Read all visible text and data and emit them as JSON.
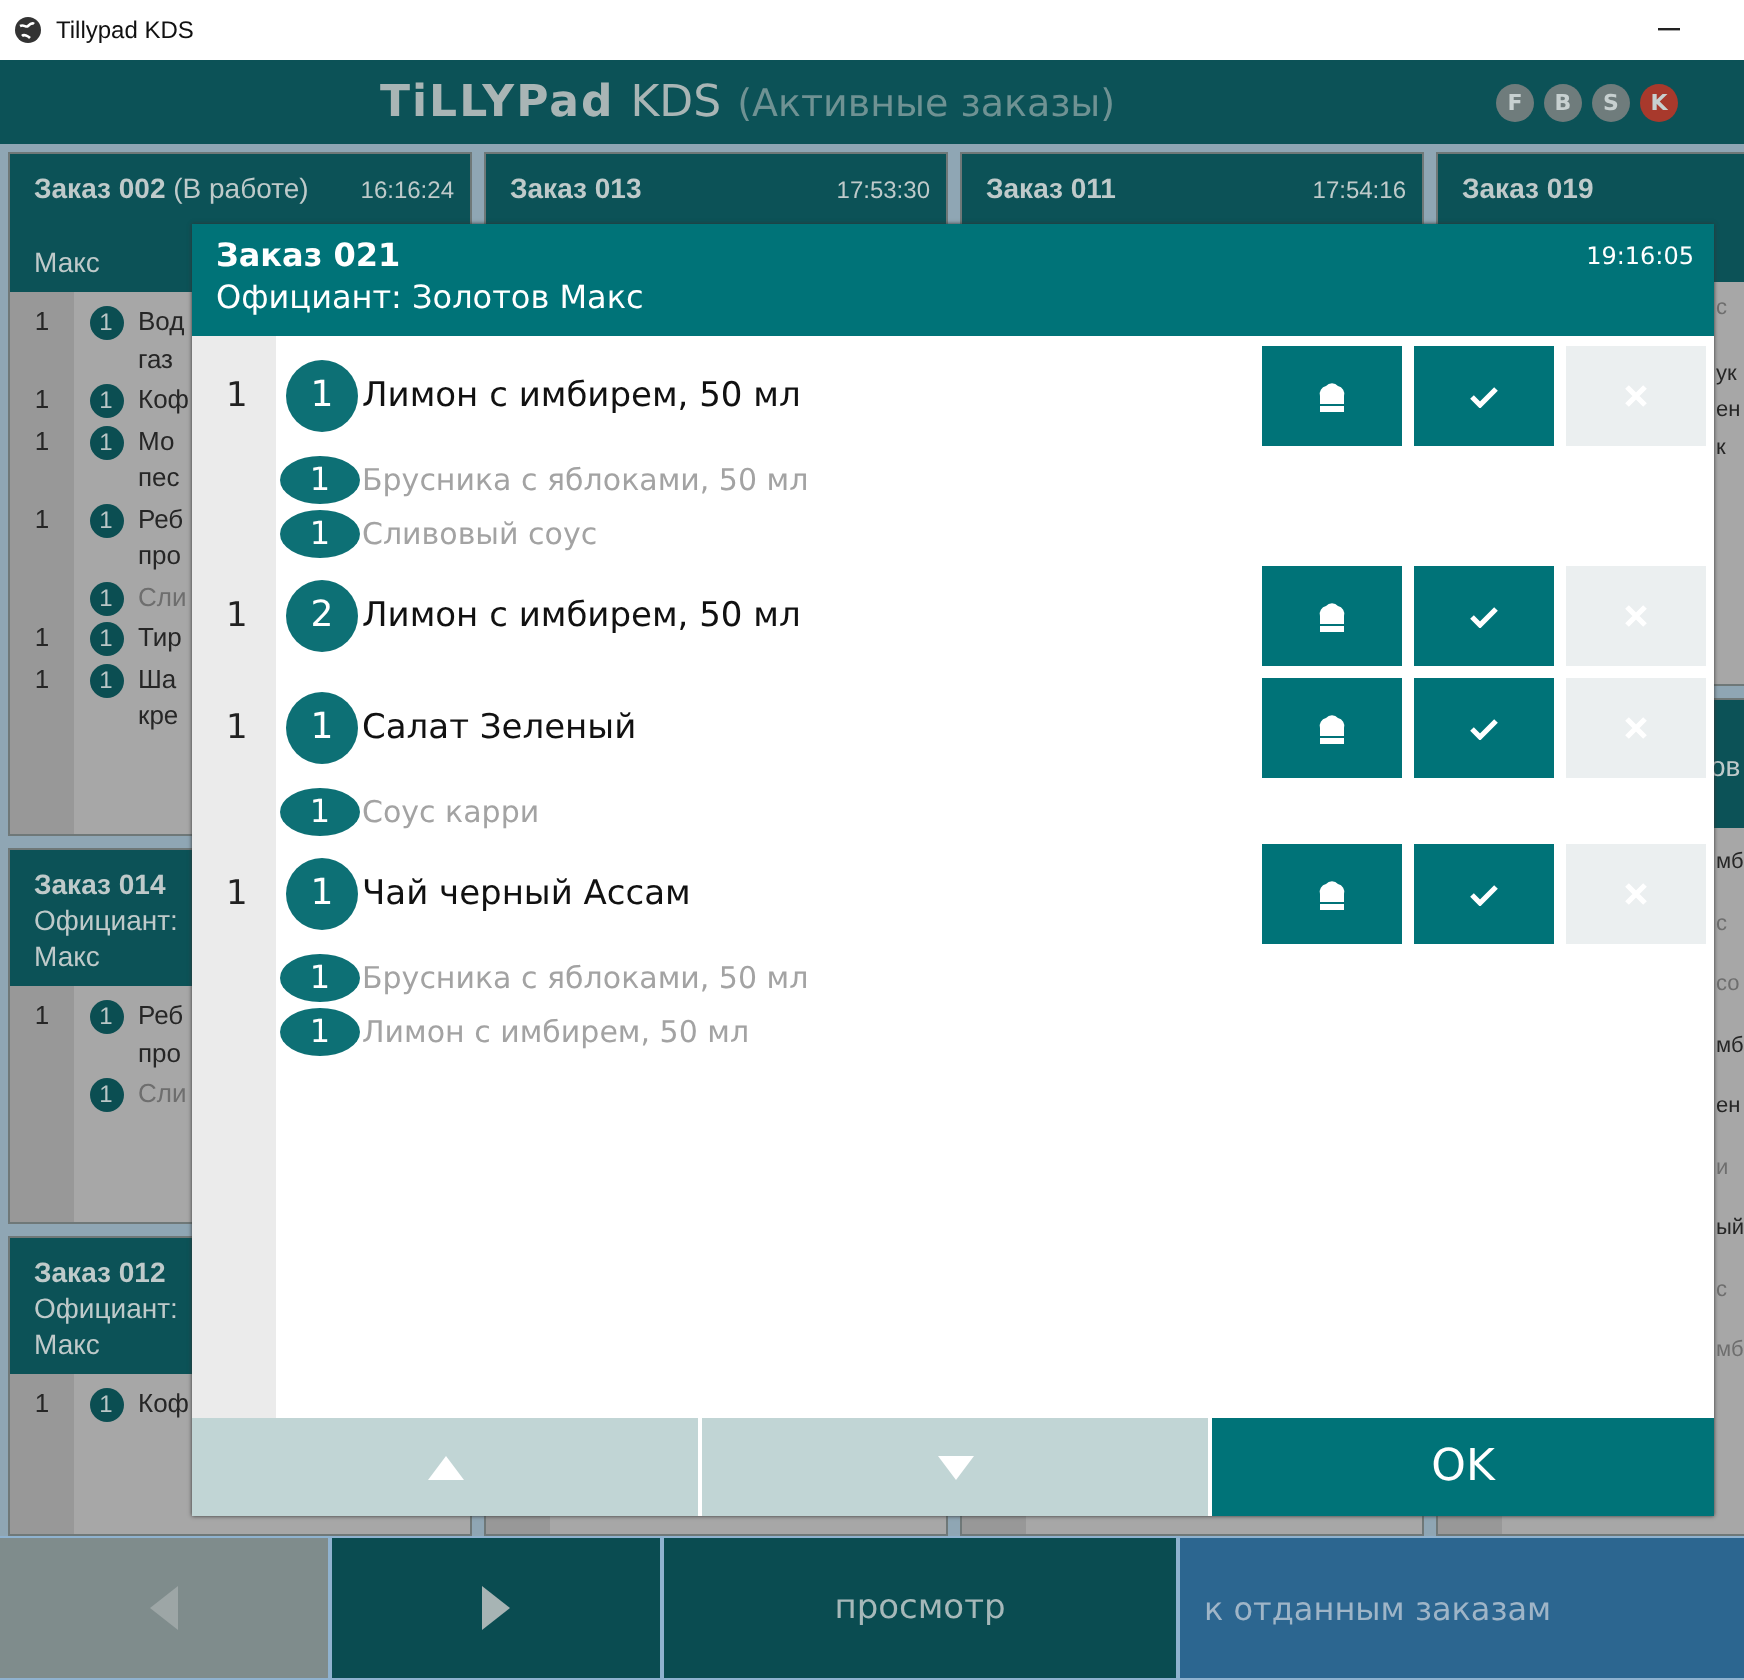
{
  "window": {
    "title": "Tillypad KDS"
  },
  "header": {
    "logo": "TiLLYPad",
    "product": "KDS",
    "view": "(Активные заказы)",
    "stations": [
      {
        "label": "F",
        "color": "#6f7c7c"
      },
      {
        "label": "B",
        "color": "#6f7c7c"
      },
      {
        "label": "S",
        "color": "#6f7c7c"
      },
      {
        "label": "K",
        "color": "#a8392c"
      }
    ]
  },
  "columns": [
    {
      "cards": [
        {
          "title": "**Заказ 002** (В работе)",
          "time": "16:16:24",
          "waiter": [
            "Макс"
          ],
          "items": [
            {
              "kind": "dish",
              "qty": "1",
              "count": "1",
              "lines": [
                "Вод",
                "газ"
              ]
            },
            {
              "kind": "dish",
              "qty": "1",
              "count": "1",
              "lines": [
                "Коф"
              ]
            },
            {
              "kind": "dish",
              "qty": "1",
              "count": "1",
              "lines": [
                "Мо",
                "пес"
              ]
            },
            {
              "kind": "dish",
              "qty": "1",
              "count": "1",
              "lines": [
                "Реб",
                "про"
              ]
            },
            {
              "kind": "modifier",
              "count": "1",
              "lines": [
                "Сли"
              ]
            },
            {
              "kind": "dish",
              "qty": "1",
              "count": "1",
              "lines": [
                "Тир"
              ]
            },
            {
              "kind": "dish",
              "qty": "1",
              "count": "1",
              "lines": [
                "Ша",
                "кре"
              ]
            }
          ]
        },
        {
          "title": "**Заказ 014**",
          "waiter": [
            "Официант:",
            "Макс"
          ],
          "items": [
            {
              "kind": "dish",
              "qty": "1",
              "count": "1",
              "lines": [
                "Реб",
                "про"
              ]
            },
            {
              "kind": "modifier",
              "count": "1",
              "lines": [
                "Сли"
              ]
            }
          ]
        },
        {
          "title": "**Заказ 012**",
          "waiter": [
            "Официант:",
            "Макс"
          ],
          "items": [
            {
              "kind": "dish",
              "qty": "1",
              "count": "1",
              "lines": [
                "Коф"
              ]
            }
          ]
        }
      ]
    },
    {
      "cards": [
        {
          "title": "**Заказ 013**",
          "time": "17:53:30"
        }
      ]
    },
    {
      "cards": [
        {
          "title": "**Заказ 011**",
          "time": "17:54:16"
        }
      ]
    },
    {
      "cards": [
        {
          "title": "**Заказ 019**",
          "items": [
            {
              "kind": "modifier",
              "lines": [
                "с"
              ]
            },
            {
              "kind": "dish",
              "lines": [
                "ук",
                "ен",
                "к"
              ]
            }
          ]
        },
        {
          "waiter": [
            "ов"
          ],
          "items": [
            {
              "kind": "dish",
              "lines": [
                "мб"
              ]
            },
            {
              "kind": "modifier",
              "lines": [
                "с"
              ]
            },
            {
              "kind": "modifier",
              "lines": [
                "со"
              ]
            },
            {
              "kind": "dish",
              "lines": [
                "мб"
              ]
            },
            {
              "kind": "dish",
              "lines": [
                "ен"
              ]
            },
            {
              "kind": "modifier",
              "lines": [
                "и"
              ]
            },
            {
              "kind": "dish",
              "lines": [
                "ый"
              ]
            },
            {
              "kind": "modifier",
              "lines": [
                "с"
              ]
            },
            {
              "kind": "modifier",
              "lines": [
                "мб"
              ]
            }
          ]
        }
      ]
    }
  ],
  "dialog": {
    "title": "Заказ 021",
    "waiter": "Официант: Золотов Макс",
    "time": "19:16:05",
    "items": [
      {
        "kind": "dish",
        "qty": "1",
        "count": "1",
        "name": "Лимон с имбирем, 50 мл",
        "cancel_disabled": true
      },
      {
        "kind": "modifier",
        "count": "1",
        "name": "Брусника с яблоками, 50 мл"
      },
      {
        "kind": "modifier",
        "count": "1",
        "name": "Сливовый соус"
      },
      {
        "kind": "dish",
        "qty": "1",
        "count": "2",
        "name": "Лимон с имбирем, 50 мл",
        "cancel_disabled": true
      },
      {
        "kind": "dish",
        "qty": "1",
        "count": "1",
        "name": "Салат Зеленый",
        "cancel_disabled": true
      },
      {
        "kind": "modifier",
        "count": "1",
        "name": "Соус карри"
      },
      {
        "kind": "dish",
        "qty": "1",
        "count": "1",
        "name": "Чай черный Ассам",
        "cancel_disabled": true
      },
      {
        "kind": "modifier",
        "count": "1",
        "name": "Брусника с яблоками, 50 мл"
      },
      {
        "kind": "modifier",
        "count": "1",
        "name": "Лимон с имбирем, 50 мл"
      }
    ],
    "ok": "OK"
  },
  "bottom_bar": [
    {
      "kind": "prev",
      "disabled": true
    },
    {
      "kind": "next",
      "disabled": false
    },
    {
      "kind": "text",
      "label": "просмотр"
    },
    {
      "kind": "text",
      "label": "к отданным заказам",
      "accent": true
    }
  ]
}
